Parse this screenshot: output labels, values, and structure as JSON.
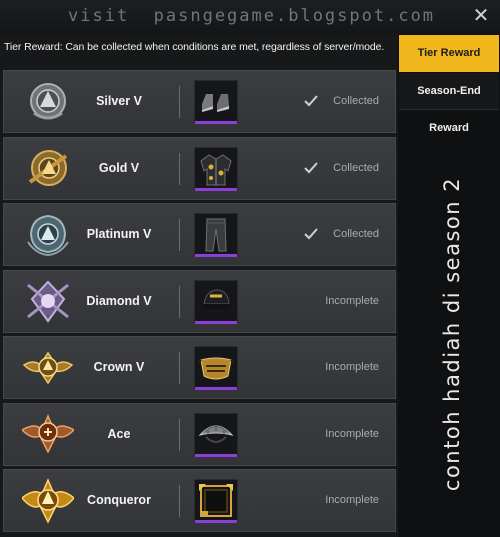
{
  "watermark": "visit  pasngegame.blogspot.com",
  "close_label": "✕",
  "notice": "Tier Reward: Can be collected when conditions are met, regardless of server/mode.",
  "tabs": {
    "tier_reward": "Tier Reward",
    "season_end_reward": "Season-End Reward"
  },
  "side_caption": "contoh hadiah di season 2",
  "colors": {
    "accent": "#f1b71d",
    "item_rarity_bar": "#8a3fd6",
    "row_bg": "#3b3d40"
  },
  "tiers": [
    {
      "name": "Silver V",
      "emblem": "silver-emblem-icon",
      "item": "shoes-icon",
      "status": "Collected",
      "collected": true
    },
    {
      "name": "Gold V",
      "emblem": "gold-emblem-icon",
      "item": "jacket-icon",
      "status": "Collected",
      "collected": true
    },
    {
      "name": "Platinum V",
      "emblem": "platinum-emblem-icon",
      "item": "pants-icon",
      "status": "Collected",
      "collected": true
    },
    {
      "name": "Diamond V",
      "emblem": "diamond-emblem-icon",
      "item": "cap-icon",
      "status": "Incomplete",
      "collected": false
    },
    {
      "name": "Crown V",
      "emblem": "crown-emblem-icon",
      "item": "mask-icon",
      "status": "Incomplete",
      "collected": false
    },
    {
      "name": "Ace",
      "emblem": "ace-emblem-icon",
      "item": "parachute-icon",
      "status": "Incomplete",
      "collected": false
    },
    {
      "name": "Conqueror",
      "emblem": "conqueror-emblem-icon",
      "item": "avatar-frame-icon",
      "status": "Incomplete",
      "collected": false
    }
  ]
}
